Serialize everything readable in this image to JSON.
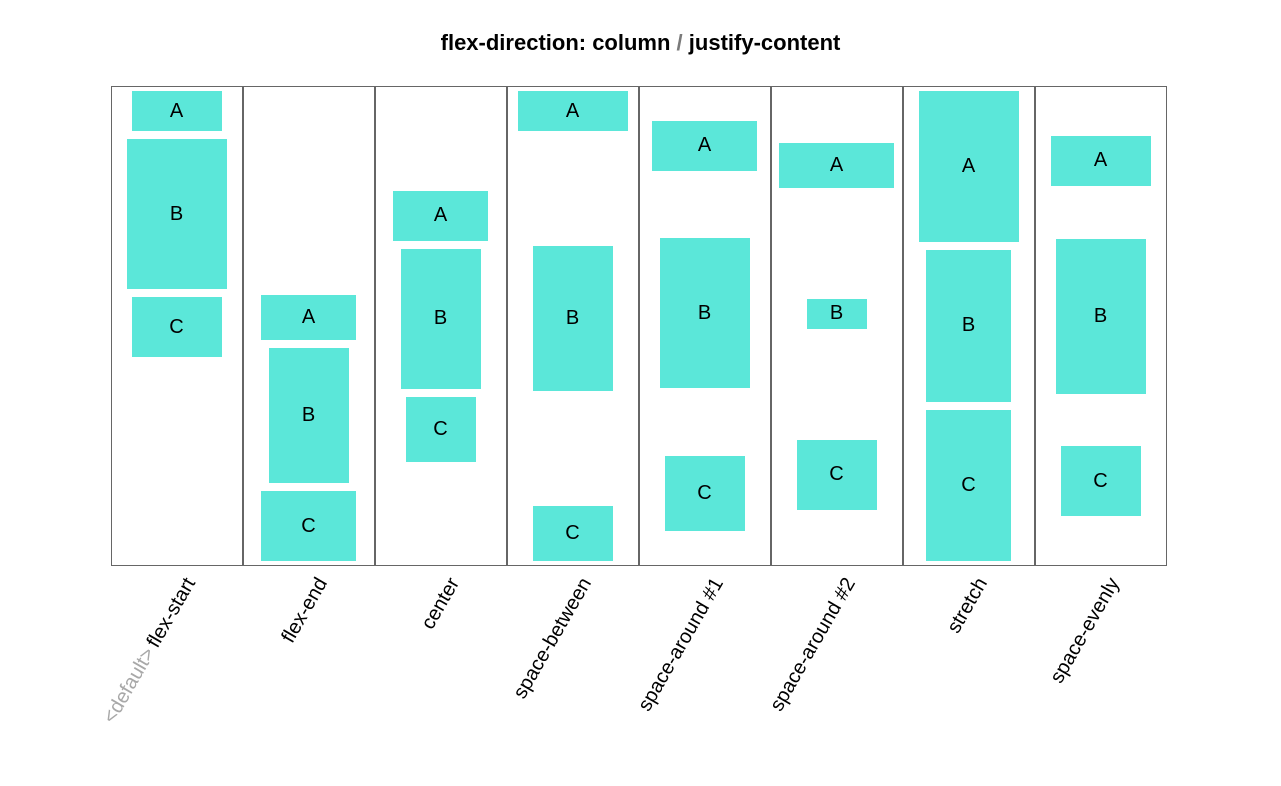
{
  "title_prefix": "flex-direction: column",
  "title_slash": "/",
  "title_suffix": "justify-content",
  "default_tag": "<default>",
  "item_labels": {
    "a": "A",
    "b": "B",
    "c": "C"
  },
  "columns": [
    {
      "id": "flex-start",
      "label": "flex-start",
      "default": true,
      "justify": "flex-start",
      "stretch": false,
      "a_w": 90,
      "a_h": 40,
      "b_w": 100,
      "b_h": 150,
      "c_w": 90,
      "c_h": 60
    },
    {
      "id": "flex-end",
      "label": "flex-end",
      "default": false,
      "justify": "flex-end",
      "stretch": false,
      "a_w": 95,
      "a_h": 45,
      "b_w": 80,
      "b_h": 135,
      "c_w": 95,
      "c_h": 70
    },
    {
      "id": "center",
      "label": "center",
      "default": false,
      "justify": "center",
      "stretch": false,
      "a_w": 95,
      "a_h": 50,
      "b_w": 80,
      "b_h": 140,
      "c_w": 70,
      "c_h": 65
    },
    {
      "id": "space-between",
      "label": "space-between",
      "default": false,
      "justify": "space-between",
      "stretch": false,
      "a_w": 110,
      "a_h": 40,
      "b_w": 80,
      "b_h": 145,
      "c_w": 80,
      "c_h": 55
    },
    {
      "id": "space-around-1",
      "label": "space-around #1",
      "default": false,
      "justify": "space-around",
      "stretch": false,
      "a_w": 105,
      "a_h": 50,
      "b_w": 90,
      "b_h": 150,
      "c_w": 80,
      "c_h": 75
    },
    {
      "id": "space-around-2",
      "label": "space-around #2",
      "default": false,
      "justify": "space-around",
      "stretch": false,
      "a_w": 115,
      "a_h": 45,
      "b_w": 60,
      "b_h": 30,
      "c_w": 80,
      "c_h": 70
    },
    {
      "id": "stretch",
      "label": "stretch",
      "default": false,
      "justify": "flex-start",
      "stretch": true,
      "a_w": 100,
      "a_h": 0,
      "b_w": 85,
      "b_h": 0,
      "c_w": 85,
      "c_h": 0
    },
    {
      "id": "space-evenly",
      "label": "space-evenly",
      "default": false,
      "justify": "space-evenly",
      "stretch": false,
      "a_w": 100,
      "a_h": 50,
      "b_w": 90,
      "b_h": 155,
      "c_w": 80,
      "c_h": 70
    }
  ]
}
